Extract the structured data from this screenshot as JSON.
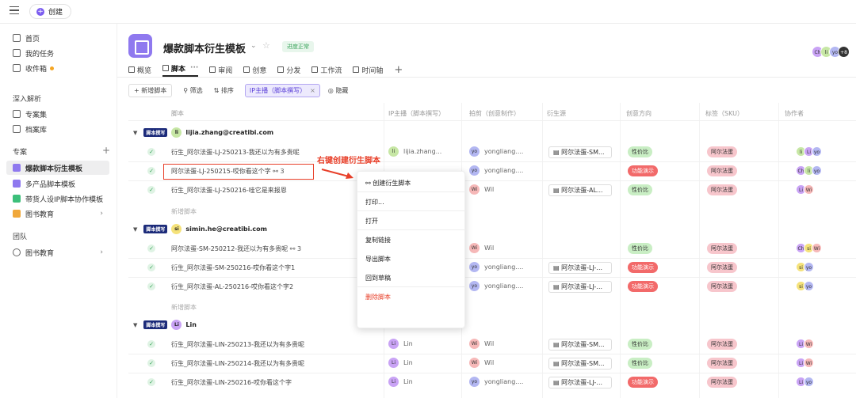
{
  "topbar": {
    "create_label": "创建"
  },
  "sidebar": {
    "home": "首页",
    "tasks": "我的任务",
    "inbox": "收件箱",
    "deep_section": "深入解析",
    "collections": "专案集",
    "archive": "档案库",
    "projects_section": "专案",
    "projects": [
      {
        "label": "爆款脚本衍生模板",
        "color": "#8f79ef"
      },
      {
        "label": "多产品脚本模板",
        "color": "#8f79ef"
      },
      {
        "label": "带货人设IP脚本协作模板",
        "color": "#3cbf7a"
      },
      {
        "label": "图书教育",
        "color": "#f0a83b"
      }
    ],
    "team_section": "团队",
    "team_item": "图书教育"
  },
  "header": {
    "title": "爆款脚本衍生模板",
    "status": "进度正常",
    "avatars": [
      "Ch",
      "li",
      "yo",
      "+8"
    ]
  },
  "tabs": [
    "概览",
    "脚本",
    "审阅",
    "创意",
    "分发",
    "工作流",
    "时间轴"
  ],
  "toolbar": {
    "new_script": "新增脚本",
    "filter": "筛选",
    "sort": "排序",
    "active_filter": "IP主播（脚本撰写）",
    "hide": "隐藏"
  },
  "columns": [
    "脚本",
    "IP主播（脚本撰写）",
    "拍剪（创意制作）",
    "衍生源",
    "创意方向",
    "标签（SKU）",
    "协作者"
  ],
  "group_tag": "脚本撰写",
  "add_script": "新增脚本",
  "groups": [
    {
      "email": "lijia.zhang@creatibi.com",
      "avatar": "li"
    },
    {
      "email": "simin.he@creatibi.com",
      "avatar": "si"
    },
    {
      "email": "Lin",
      "avatar": "Li"
    }
  ],
  "rows": [
    {
      "name": "衍生_阿尔法蛋-LJ-250213-我还以为有多贵呢",
      "ip": "lijia.zhang...",
      "ip_av": "li",
      "shoot": "yongliang....",
      "src": "阿尔法蛋-SM...",
      "dir": "性价比",
      "tag": "阿尔法蛋",
      "collab": [
        "li",
        "Li",
        "yo"
      ]
    },
    {
      "name": "阿尔法蛋-LJ-250215-哎你看这个字",
      "count": "3",
      "ip": "",
      "ip_av": "",
      "shoot": "yongliang....",
      "src": "",
      "dir": "功能演示",
      "tag": "阿尔法蛋",
      "collab": [
        "Ch",
        "li",
        "yo"
      ]
    },
    {
      "name": "衍生_阿尔法蛋-LJ-250216-哇它是来报恩",
      "ip": "",
      "ip_av": "",
      "shoot": "Wil",
      "src": "阿尔法蛋-AL...",
      "dir": "性价比",
      "tag": "阿尔法蛋",
      "collab": [
        "Li",
        "Wi"
      ]
    },
    {
      "name": "阿尔法蛋-SM-250212-我还以为有多贵呢",
      "count": "3",
      "ip": "",
      "ip_av": "",
      "shoot": "Wil",
      "src": "",
      "dir": "性价比",
      "tag": "阿尔法蛋",
      "collab": [
        "Ch",
        "si",
        "Wi"
      ]
    },
    {
      "name": "衍生_阿尔法蛋-SM-250216-哎你看这个字1",
      "ip": "",
      "ip_av": "",
      "shoot": "yongliang....",
      "src": "阿尔法蛋-LJ-...",
      "dir": "功能演示",
      "tag": "阿尔法蛋",
      "collab": [
        "si",
        "yo"
      ]
    },
    {
      "name": "衍生_阿尔法蛋-AL-250216-哎你看这个字2",
      "ip": "",
      "ip_av": "",
      "shoot": "yongliang....",
      "src": "阿尔法蛋-LJ-...",
      "dir": "功能演示",
      "tag": "阿尔法蛋",
      "collab": [
        "si",
        "yo"
      ]
    },
    {
      "name": "衍生_阿尔法蛋-LIN-250213-我还以为有多贵呢",
      "ip": "Lin",
      "ip_av": "Li",
      "shoot": "Wil",
      "src": "阿尔法蛋-SM...",
      "dir": "性价比",
      "tag": "阿尔法蛋",
      "collab": [
        "Li",
        "Wi"
      ]
    },
    {
      "name": "衍生_阿尔法蛋-LIN-250214-我还以为有多贵呢",
      "ip": "Lin",
      "ip_av": "Li",
      "shoot": "Wil",
      "src": "阿尔法蛋-SM...",
      "dir": "性价比",
      "tag": "阿尔法蛋",
      "collab": [
        "Li",
        "Wi"
      ]
    },
    {
      "name": "衍生_阿尔法蛋-LIN-250216-哎你看这个字",
      "ip": "Lin",
      "ip_av": "Li",
      "shoot": "yongliang....",
      "src": "阿尔法蛋-LJ-...",
      "dir": "功能演示",
      "tag": "阿尔法蛋",
      "collab": [
        "Li",
        "yo"
      ]
    }
  ],
  "annotation": "右键创建衍生脚本",
  "context_menu": [
    "创建衍生脚本",
    "打印...",
    "打开",
    "复制链接",
    "导出脚本",
    "回到草稿",
    "删除脚本"
  ]
}
